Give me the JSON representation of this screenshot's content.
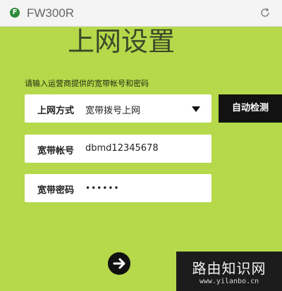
{
  "browser": {
    "address": "FW300R",
    "favicon_glyph": "F",
    "favicon_icon": "site-favicon",
    "reload_icon": "reload-icon"
  },
  "page": {
    "title": "上网设置",
    "instruction": "请输入运营商提供的宽带帐号和密码"
  },
  "form": {
    "connection_type": {
      "label": "上网方式",
      "value": "宽带拨号上网",
      "icon": "dropdown-caret-icon"
    },
    "account": {
      "label": "宽带帐号",
      "value": "dbmd12345678"
    },
    "password": {
      "label": "宽带密码",
      "value": "••••••"
    },
    "detect_button": "自动检测",
    "next_button_icon": "arrow-right-icon"
  },
  "watermark": {
    "title": "路由知识网",
    "url": "www.yilanbo.cn"
  },
  "colors": {
    "background": "#b5d94a",
    "title": "#3b4a2a",
    "button": "#121212",
    "field": "#ffffff"
  }
}
